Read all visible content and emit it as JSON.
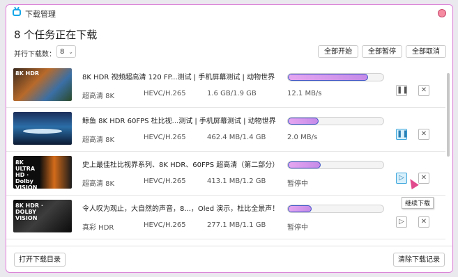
{
  "window": {
    "title": "下载管理"
  },
  "heading": "8 个任务正在下载",
  "parallel": {
    "label": "并行下载数：",
    "value": "8"
  },
  "actions": {
    "start_all": "全部开始",
    "pause_all": "全部暂停",
    "cancel_all": "全部取消"
  },
  "tasks": [
    {
      "title": "8K HDR 视频超高清 120 FP...测试 | 手机屏幕测试 | 动物世界",
      "quality": "超高清 8K",
      "codec": "HEVC/H.265",
      "size": "1.6 GB/1.9 GB",
      "speed": "12.1 MB/s",
      "progress": 0.84,
      "thumb_label": "8K HDR",
      "action": "pause"
    },
    {
      "title": "鲸鱼 8K HDR 60FPS 杜比视...测试 | 手机屏幕测试 | 动物世界",
      "quality": "超高清 8K",
      "codec": "HEVC/H.265",
      "size": "462.4 MB/1.4 GB",
      "speed": "2.0 MB/s",
      "progress": 0.32,
      "thumb_label": "",
      "action": "pause"
    },
    {
      "title": "史上最佳杜比视界系列、8K HDR、60FPS 超高清（第二部分）",
      "quality": "超高清 8K",
      "codec": "HEVC/H.265",
      "size": "413.1 MB/1.2 GB",
      "speed": "暂停中",
      "progress": 0.34,
      "thumb_label": "8K ULTRA HD · Dolby VISION",
      "action": "resume"
    },
    {
      "title": "令人叹为观止，大自然的声音，8...，Oled 演示，杜比全景声！",
      "quality": "真彩 HDR",
      "codec": "HEVC/H.265",
      "size": "277.1 MB/1.1 GB",
      "speed": "暂停中",
      "progress": 0.25,
      "thumb_label": "8K HDR · DOLBY VISION",
      "action": "resume"
    }
  ],
  "tooltip": "继续下载",
  "footer": {
    "open_dir": "打开下载目录",
    "clear": "清除下载记录"
  },
  "colors": {
    "accent": "#3fa7dc",
    "progress_fill": "#d79ded",
    "progress_border": "#3e55c8"
  }
}
